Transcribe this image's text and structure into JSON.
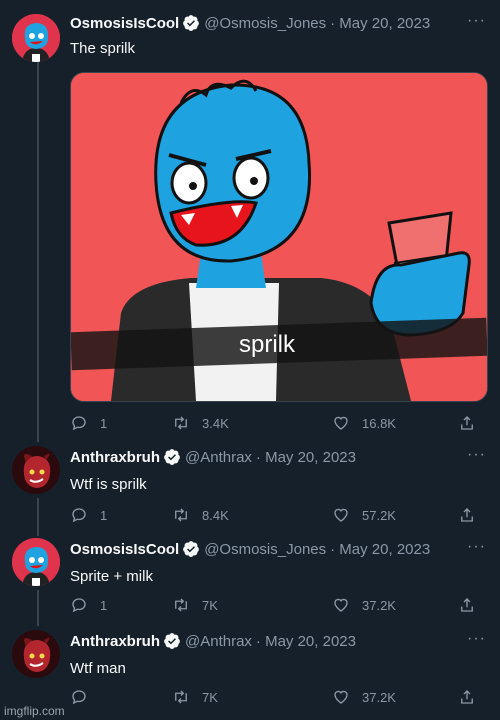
{
  "tweets": [
    {
      "name": "OsmosisIsCool",
      "handle": "@Osmosis_Jones",
      "date": "· May 20, 2023",
      "text": "The sprilk",
      "replies": "1",
      "retweets": "3.4K",
      "likes": "16.8K",
      "media_caption": "sprilk"
    },
    {
      "name": "Anthraxbruh",
      "handle": "@Anthrax",
      "date": "· May 20, 2023",
      "text": "Wtf is sprilk",
      "replies": "1",
      "retweets": "8.4K",
      "likes": "57.2K"
    },
    {
      "name": "OsmosisIsCool",
      "handle": "@Osmosis_Jones",
      "date": "· May 20, 2023",
      "text": "Sprite + milk",
      "replies": "1",
      "retweets": "7K",
      "likes": "37.2K"
    },
    {
      "name": "Anthraxbruh",
      "handle": "@Anthrax",
      "date": "· May 20, 2023",
      "text": "Wtf man",
      "replies": "",
      "retweets": "7K",
      "likes": "37.2K"
    }
  ],
  "more_label": "···",
  "watermark": "imgflip.com",
  "colors": {
    "background": "#15202b",
    "secondary_text": "#8b98a5",
    "verified": "#1d9bf0",
    "media_background": "#f15555"
  }
}
